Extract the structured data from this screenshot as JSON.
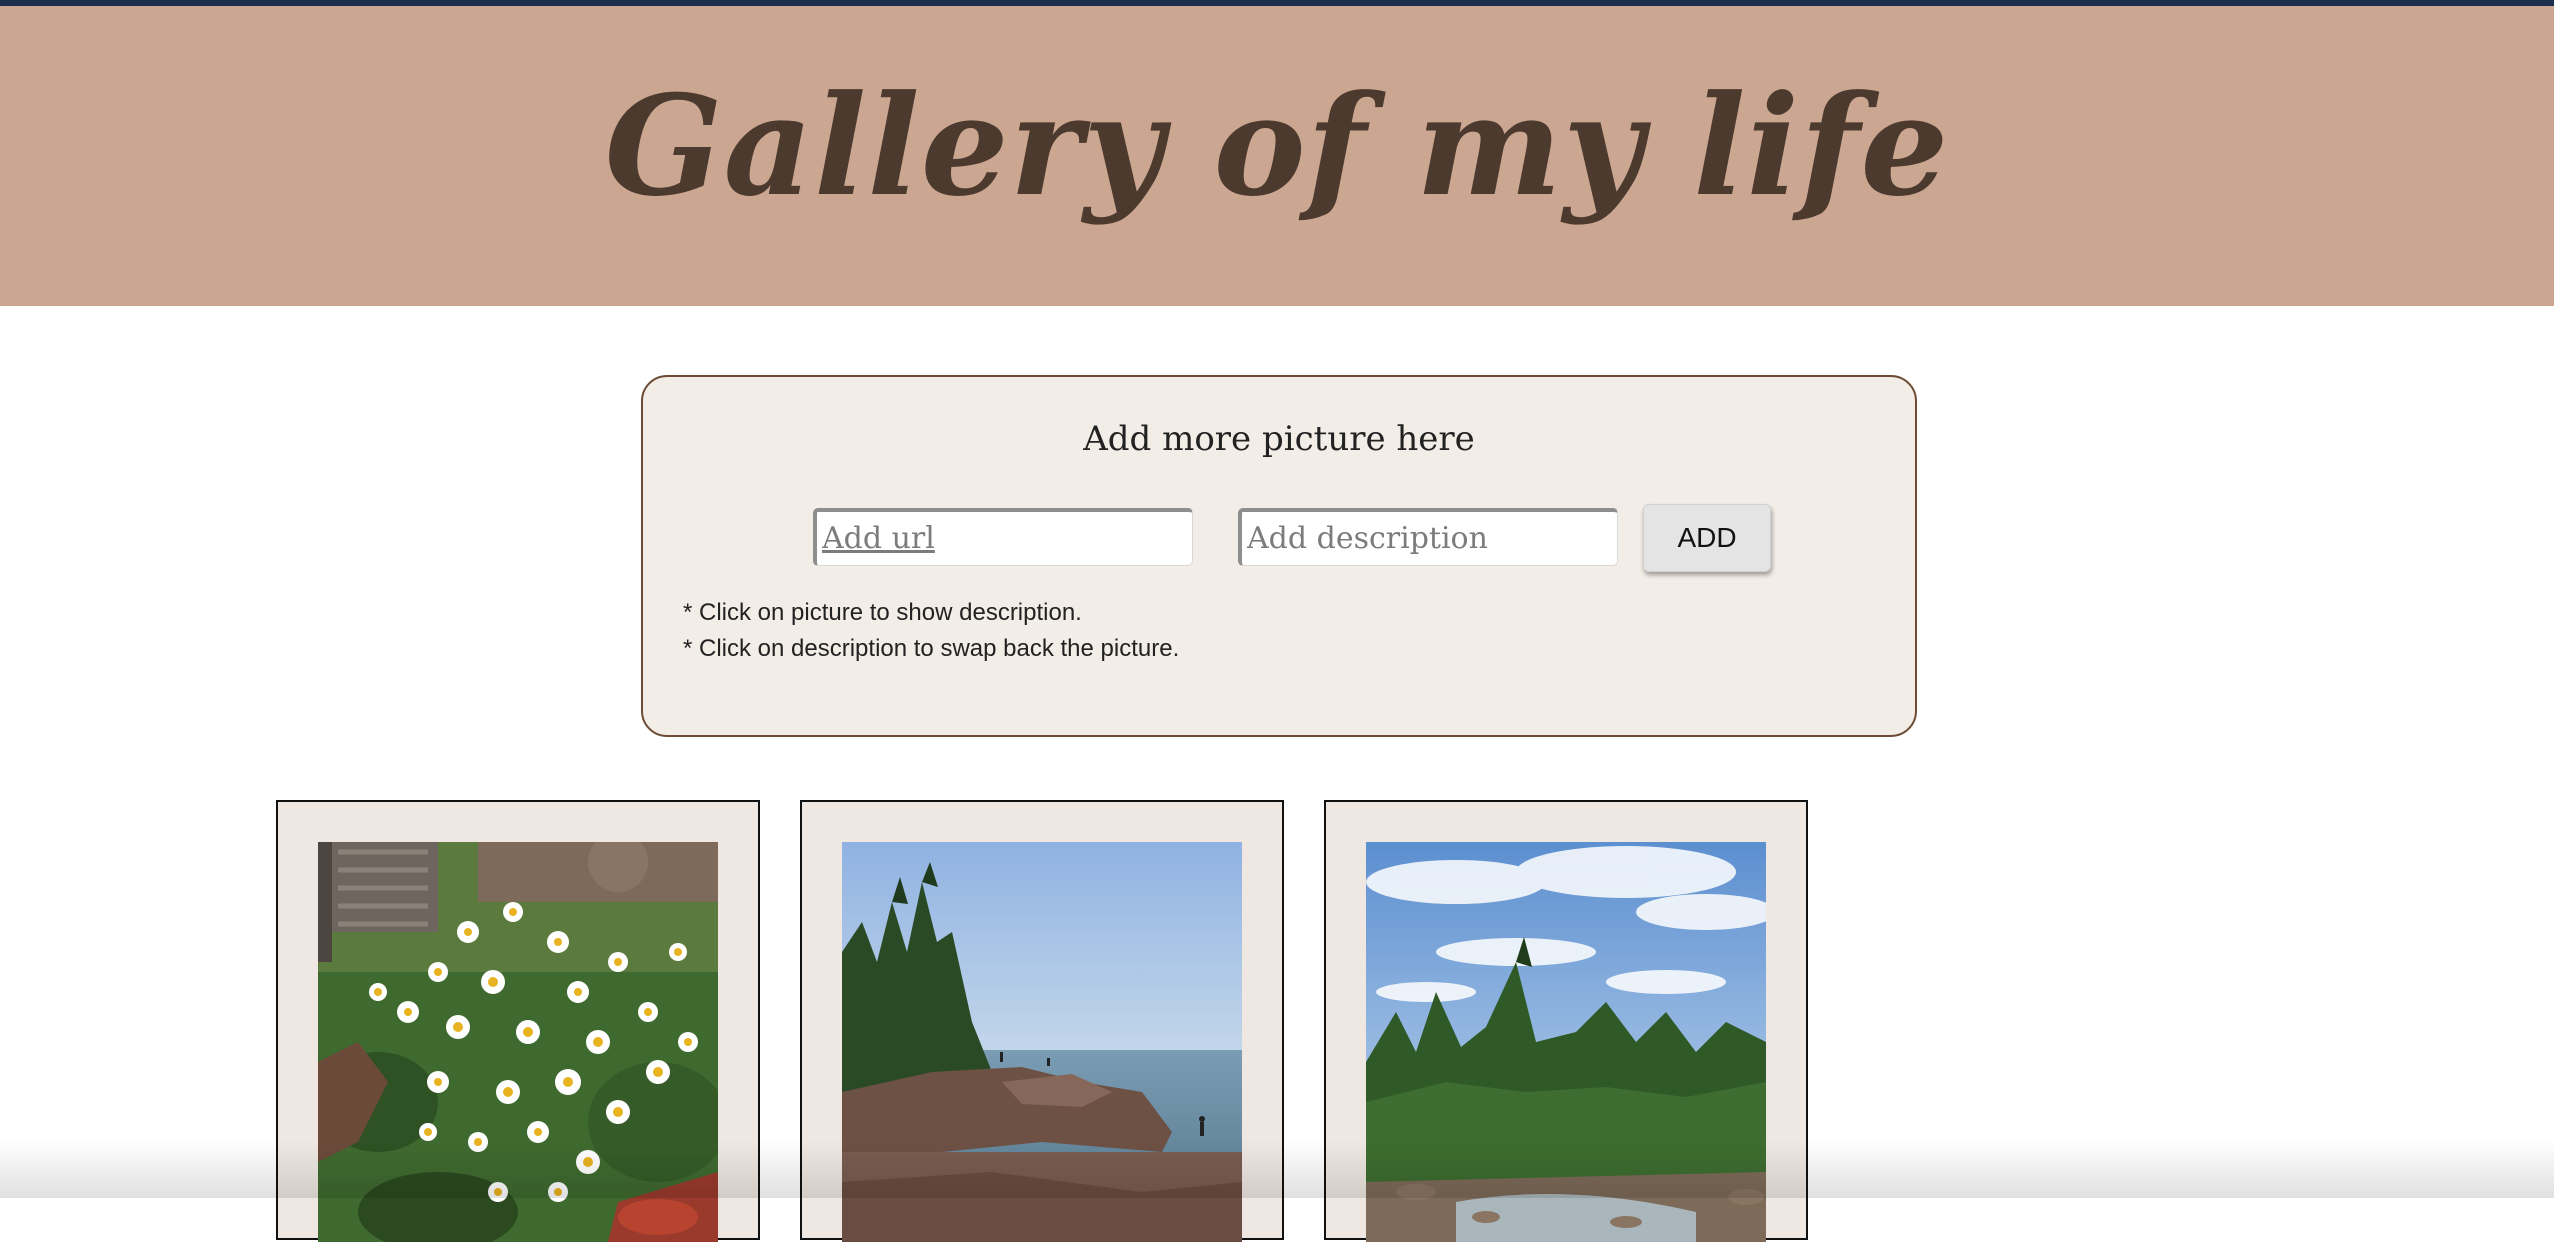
{
  "header": {
    "title": "Gallery of my life",
    "background_color": "#cba792",
    "top_line_color": "#1e2f4d"
  },
  "add_panel": {
    "title": "Add more picture here",
    "url_input": {
      "placeholder": "Add url",
      "value": ""
    },
    "description_input": {
      "placeholder": "Add description",
      "value": ""
    },
    "add_button_label": "ADD",
    "hints": [
      "* Click on picture to show description.",
      "* Click on description to swap back the picture."
    ],
    "background_color": "#f3ede7",
    "border_color": "#6e4b34"
  },
  "gallery": {
    "cards": [
      {
        "photo": "daisy-flowers-photo"
      },
      {
        "photo": "lake-shore-rocks-photo"
      },
      {
        "photo": "forest-river-sky-photo"
      }
    ]
  }
}
